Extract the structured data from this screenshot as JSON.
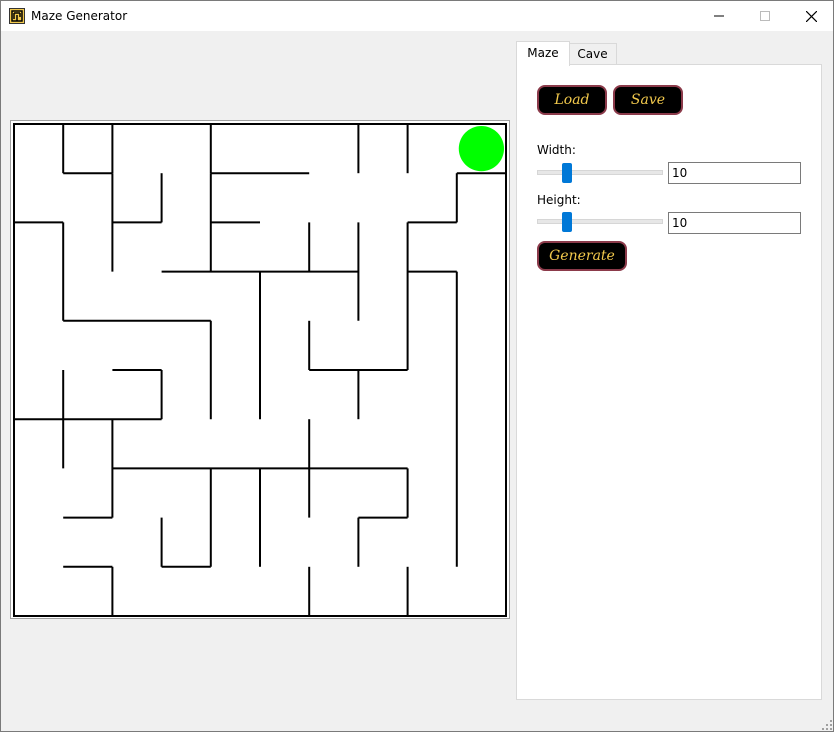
{
  "window": {
    "title": "Maze Generator",
    "controls": [
      "minimize-icon",
      "maximize-icon",
      "close-icon"
    ]
  },
  "tabs": [
    {
      "label": "Maze",
      "active": true
    },
    {
      "label": "Cave",
      "active": false
    }
  ],
  "maze_panel": {
    "load_label": "Load",
    "save_label": "Save",
    "width_label": "Width:",
    "width_value": "10",
    "width_slider_fraction": 0.2,
    "height_label": "Height:",
    "height_value": "10",
    "height_slider_fraction": 0.2,
    "generate_label": "Generate"
  },
  "maze": {
    "cols": 10,
    "rows": 10,
    "player_cell": [
      9,
      0
    ],
    "player_color": "#00ff00",
    "walls": [
      [
        1,
        0,
        1,
        1
      ],
      [
        2,
        0,
        2,
        1
      ],
      [
        4,
        0,
        4,
        1
      ],
      [
        7,
        0,
        7,
        1
      ],
      [
        8,
        0,
        8,
        1
      ],
      [
        4,
        1,
        6,
        1
      ],
      [
        9,
        1,
        10,
        1
      ],
      [
        1,
        1,
        2,
        1
      ],
      [
        0,
        2,
        1,
        2
      ],
      [
        3,
        1,
        3,
        2
      ],
      [
        2,
        2,
        3,
        2
      ],
      [
        2,
        1,
        2,
        3
      ],
      [
        4,
        1,
        4,
        3
      ],
      [
        9,
        1,
        9,
        2
      ],
      [
        4,
        2,
        5,
        2
      ],
      [
        8,
        2,
        9,
        2
      ],
      [
        6,
        2,
        6,
        3
      ],
      [
        8,
        2,
        8,
        5
      ],
      [
        7,
        2,
        7,
        4
      ],
      [
        3,
        3,
        7,
        3
      ],
      [
        1,
        2,
        1,
        4
      ],
      [
        5,
        3,
        5,
        6
      ],
      [
        8,
        3,
        9,
        3
      ],
      [
        9,
        3,
        9,
        9
      ],
      [
        1,
        4,
        4,
        4
      ],
      [
        6,
        4,
        6,
        5
      ],
      [
        4,
        4,
        4,
        6
      ],
      [
        6,
        5,
        8,
        5
      ],
      [
        7,
        5,
        7,
        6
      ],
      [
        1,
        5,
        1,
        7
      ],
      [
        2,
        5,
        3,
        5
      ],
      [
        3,
        5,
        3,
        6
      ],
      [
        0,
        6,
        3,
        6
      ],
      [
        2,
        6,
        2,
        8
      ],
      [
        6,
        6,
        6,
        7
      ],
      [
        2,
        7,
        8,
        7
      ],
      [
        4,
        7,
        4,
        9
      ],
      [
        5,
        7,
        5,
        9
      ],
      [
        6,
        7,
        6,
        8
      ],
      [
        8,
        7,
        8,
        8
      ],
      [
        1,
        8,
        2,
        8
      ],
      [
        7,
        8,
        8,
        8
      ],
      [
        3,
        8,
        3,
        9
      ],
      [
        7,
        8,
        7,
        9
      ],
      [
        3,
        9,
        4,
        9
      ],
      [
        1,
        9,
        2,
        9
      ],
      [
        2,
        9,
        2,
        10
      ],
      [
        6,
        9,
        6,
        10
      ],
      [
        8,
        9,
        8,
        10
      ]
    ]
  }
}
